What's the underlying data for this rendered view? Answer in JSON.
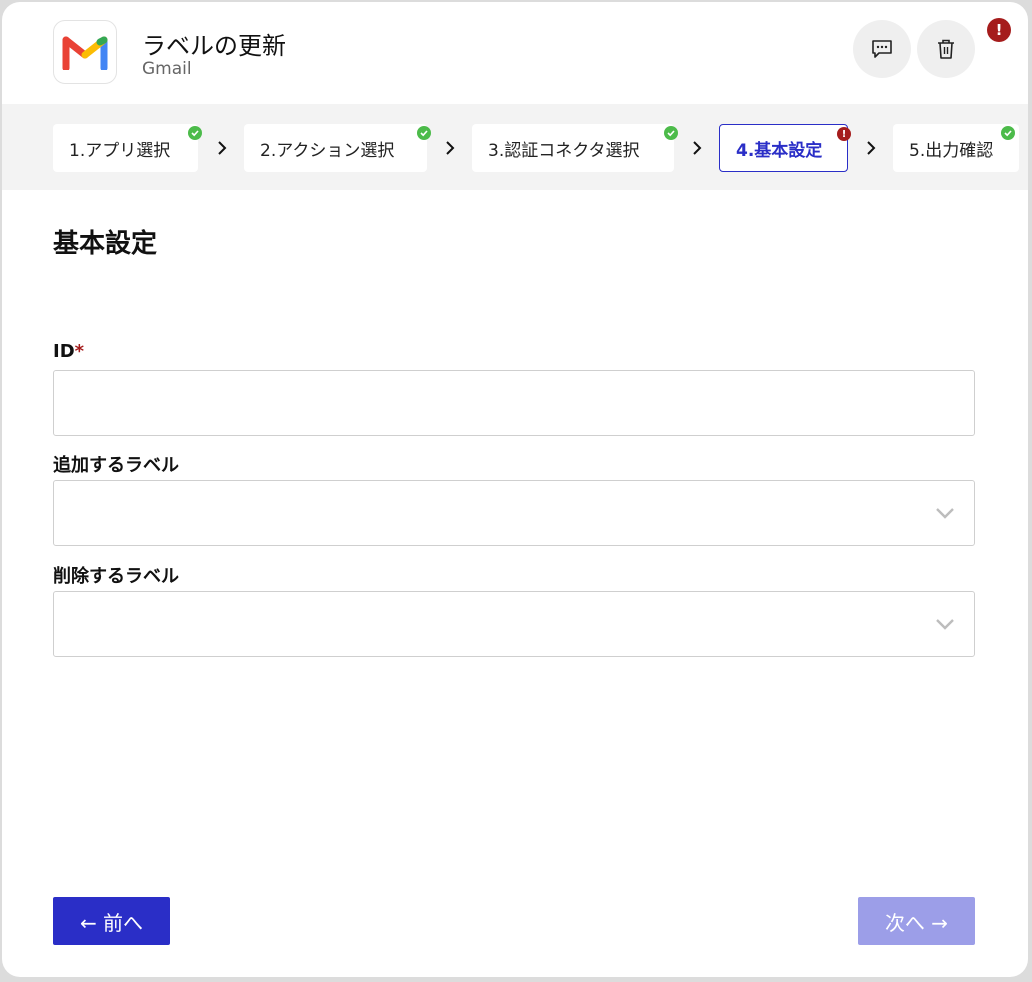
{
  "header": {
    "title": "ラベルの更新",
    "subtitle": "Gmail",
    "alert_glyph": "!"
  },
  "steps": [
    {
      "label": "1.アプリ選択",
      "status": "ok"
    },
    {
      "label": "2.アクション選択",
      "status": "ok"
    },
    {
      "label": "3.認証コネクタ選択",
      "status": "ok"
    },
    {
      "label": "4.基本設定",
      "status": "error",
      "active": true
    },
    {
      "label": "5.出力確認",
      "status": "ok"
    }
  ],
  "step_error_glyph": "!",
  "section": {
    "title": "基本設定"
  },
  "fields": {
    "id_label": "ID",
    "id_required_mark": "*",
    "add_label": "追加するラベル",
    "remove_label": "削除するラベル"
  },
  "buttons": {
    "prev": "← 前へ",
    "next": "次へ →"
  },
  "colors": {
    "primary": "#2a2ec7",
    "primary_disabled": "#9c9ee8",
    "success": "#4cbb4a",
    "error": "#a51c1c"
  },
  "icons": {
    "app": "gmail-logo-icon",
    "comment": "comment-icon",
    "trash": "trash-icon",
    "check": "check-icon",
    "chevron_right": "chevron-right-icon",
    "chevron_down": "chevron-down-icon"
  }
}
